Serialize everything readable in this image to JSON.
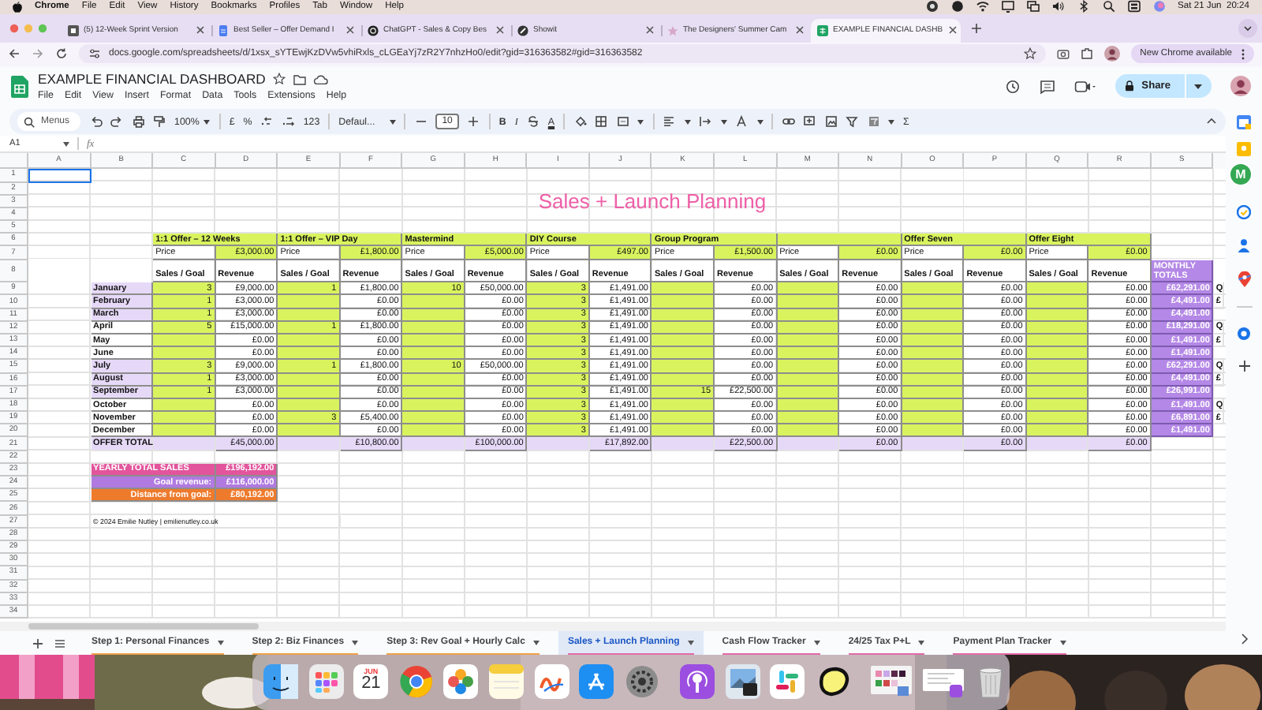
{
  "menu_bar": {
    "app": "Chrome",
    "items": [
      "File",
      "Edit",
      "View",
      "History",
      "Bookmarks",
      "Profiles",
      "Tab",
      "Window",
      "Help"
    ],
    "clock": "Sat 21 Jun  20:24"
  },
  "browser_tabs": [
    {
      "title": "(5) 12-Week Sprint Version",
      "selected": false
    },
    {
      "title": "Best Seller – Offer Demand I",
      "selected": false
    },
    {
      "title": "ChatGPT - Sales & Copy Bes",
      "selected": false
    },
    {
      "title": "Showit",
      "selected": false
    },
    {
      "title": "The Designers' Summer Cam",
      "selected": false
    },
    {
      "title": "EXAMPLE FINANCIAL DASHB",
      "selected": true
    }
  ],
  "address_bar": {
    "url": "docs.google.com/spreadsheets/d/1xsx_sYTEwjKzDVw5vhiRxls_cLGEaYj7zR2Y7nhzHo0/edit?gid=316363582#gid=316363582",
    "update_button": "New Chrome available"
  },
  "document": {
    "title": "EXAMPLE FINANCIAL DASHBOARD",
    "menus": [
      "File",
      "Edit",
      "View",
      "Insert",
      "Format",
      "Data",
      "Tools",
      "Extensions",
      "Help"
    ],
    "share": "Share"
  },
  "toolbar": {
    "search": "Menus",
    "zoom": "100%",
    "currency": "£",
    "percent": "%",
    "number_format": "123",
    "font": "Defaul...",
    "font_size": "10",
    "bold": "B",
    "italic": "I",
    "text_color": "A",
    "sum": "Σ"
  },
  "formula_bar": {
    "cell": "A1",
    "fx": "fx"
  },
  "sheet": {
    "columns": [
      "A",
      "B",
      "C",
      "D",
      "E",
      "F",
      "G",
      "H",
      "I",
      "J",
      "K",
      "L",
      "M",
      "N",
      "O",
      "P",
      "Q",
      "R",
      "S"
    ],
    "rows": [
      "1",
      "2",
      "3",
      "4",
      "5",
      "6",
      "7",
      "8",
      "9",
      "10",
      "11",
      "12",
      "13",
      "14",
      "15",
      "16",
      "17",
      "18",
      "19",
      "20",
      "21",
      "22",
      "23",
      "24",
      "25",
      "26",
      "27",
      "28",
      "29",
      "30",
      "31",
      "32",
      "33",
      "34"
    ],
    "title": "Sales + Launch Planning",
    "months": [
      {
        "name": "January",
        "shaded": true,
        "total": "£62,291.00",
        "column_t": "Q"
      },
      {
        "name": "February",
        "shaded": true,
        "total": "£4,491.00",
        "column_t": "£"
      },
      {
        "name": "March",
        "shaded": true,
        "total": "£4,491.00"
      },
      {
        "name": "April",
        "shaded": false,
        "total": "£18,291.00",
        "column_t": "Q"
      },
      {
        "name": "May",
        "shaded": false,
        "total": "£1,491.00",
        "column_t": "£"
      },
      {
        "name": "June",
        "shaded": false,
        "total": "£1,491.00"
      },
      {
        "name": "July",
        "shaded": true,
        "total": "£62,291.00",
        "column_t": "Q"
      },
      {
        "name": "August",
        "shaded": true,
        "total": "£4,491.00",
        "column_t": "£"
      },
      {
        "name": "September",
        "shaded": true,
        "total": "£26,991.00"
      },
      {
        "name": "October",
        "shaded": false,
        "total": "£1,491.00",
        "column_t": "Q"
      },
      {
        "name": "November",
        "shaded": false,
        "total": "£6,891.00",
        "column_t": "£"
      },
      {
        "name": "December",
        "shaded": false,
        "total": "£1,491.00"
      }
    ],
    "offers": [
      {
        "name": "1:1 Offer – 12 Weeks",
        "price_label": "Price",
        "price": "£3,000.00",
        "sales_header": "Sales / Goal",
        "revenue_header": "Revenue",
        "total": "£45,000.00",
        "rows": [
          {
            "sales": "3",
            "revenue": "£9,000.00"
          },
          {
            "sales": "1",
            "revenue": "£3,000.00"
          },
          {
            "sales": "1",
            "revenue": "£3,000.00"
          },
          {
            "sales": "5",
            "revenue": "£15,000.00"
          },
          {
            "revenue": "£0.00"
          },
          {
            "revenue": "£0.00"
          },
          {
            "sales": "3",
            "revenue": "£9,000.00"
          },
          {
            "sales": "1",
            "revenue": "£3,000.00"
          },
          {
            "sales": "1",
            "revenue": "£3,000.00"
          },
          {
            "revenue": "£0.00"
          },
          {
            "revenue": "£0.00"
          },
          {
            "revenue": "£0.00"
          }
        ]
      },
      {
        "name": "1:1 Offer – VIP Day",
        "price_label": "Price",
        "price": "£1,800.00",
        "sales_header": "Sales / Goal",
        "revenue_header": "Revenue",
        "total": "£10,800.00",
        "rows": [
          {
            "sales": "1",
            "revenue": "£1,800.00"
          },
          {
            "revenue": "£0.00"
          },
          {
            "revenue": "£0.00"
          },
          {
            "sales": "1",
            "revenue": "£1,800.00"
          },
          {
            "revenue": "£0.00"
          },
          {
            "revenue": "£0.00"
          },
          {
            "sales": "1",
            "revenue": "£1,800.00"
          },
          {
            "revenue": "£0.00"
          },
          {
            "revenue": "£0.00"
          },
          {
            "revenue": "£0.00"
          },
          {
            "sales": "3",
            "revenue": "£5,400.00"
          },
          {
            "revenue": "£0.00"
          }
        ]
      },
      {
        "name": "Mastermind",
        "price_label": "Price",
        "price": "£5,000.00",
        "sales_header": "Sales / Goal",
        "revenue_header": "Revenue",
        "total": "£100,000.00",
        "rows": [
          {
            "sales": "10",
            "revenue": "£50,000.00"
          },
          {
            "revenue": "£0.00"
          },
          {
            "revenue": "£0.00"
          },
          {
            "revenue": "£0.00"
          },
          {
            "revenue": "£0.00"
          },
          {
            "revenue": "£0.00"
          },
          {
            "sales": "10",
            "revenue": "£50,000.00"
          },
          {
            "revenue": "£0.00"
          },
          {
            "revenue": "£0.00"
          },
          {
            "revenue": "£0.00"
          },
          {
            "revenue": "£0.00"
          },
          {
            "revenue": "£0.00"
          }
        ]
      },
      {
        "name": "DIY Course",
        "price_label": "Price",
        "price": "£497.00",
        "sales_header": "Sales / Goal",
        "revenue_header": "Revenue",
        "total": "£17,892.00",
        "rows": [
          {
            "sales": "3",
            "revenue": "£1,491.00"
          },
          {
            "sales": "3",
            "revenue": "£1,491.00"
          },
          {
            "sales": "3",
            "revenue": "£1,491.00"
          },
          {
            "sales": "3",
            "revenue": "£1,491.00"
          },
          {
            "sales": "3",
            "revenue": "£1,491.00"
          },
          {
            "sales": "3",
            "revenue": "£1,491.00"
          },
          {
            "sales": "3",
            "revenue": "£1,491.00"
          },
          {
            "sales": "3",
            "revenue": "£1,491.00"
          },
          {
            "sales": "3",
            "revenue": "£1,491.00"
          },
          {
            "sales": "3",
            "revenue": "£1,491.00"
          },
          {
            "sales": "3",
            "revenue": "£1,491.00"
          },
          {
            "sales": "3",
            "revenue": "£1,491.00"
          }
        ]
      },
      {
        "name": "Group Program",
        "price_label": "Price",
        "price": "£1,500.00",
        "sales_header": "Sales / Goal",
        "revenue_header": "Revenue",
        "total": "£22,500.00",
        "rows": [
          {
            "revenue": "£0.00"
          },
          {
            "revenue": "£0.00"
          },
          {
            "revenue": "£0.00"
          },
          {
            "revenue": "£0.00"
          },
          {
            "revenue": "£0.00"
          },
          {
            "revenue": "£0.00"
          },
          {
            "revenue": "£0.00"
          },
          {
            "revenue": "£0.00"
          },
          {
            "sales": "15",
            "revenue": "£22,500.00"
          },
          {
            "revenue": "£0.00"
          },
          {
            "revenue": "£0.00"
          },
          {
            "revenue": "£0.00"
          }
        ]
      },
      {
        "price_label": "Price",
        "price": "£0.00",
        "sales_header": "Sales / Goal",
        "revenue_header": "Revenue",
        "total": "£0.00",
        "rows": [
          {
            "revenue": "£0.00"
          },
          {
            "revenue": "£0.00"
          },
          {
            "revenue": "£0.00"
          },
          {
            "revenue": "£0.00"
          },
          {
            "revenue": "£0.00"
          },
          {
            "revenue": "£0.00"
          },
          {
            "revenue": "£0.00"
          },
          {
            "revenue": "£0.00"
          },
          {
            "revenue": "£0.00"
          },
          {
            "revenue": "£0.00"
          },
          {
            "revenue": "£0.00"
          },
          {
            "revenue": "£0.00"
          }
        ]
      },
      {
        "name": "Offer Seven",
        "price_label": "Price",
        "price": "£0.00",
        "sales_header": "Sales / Goal",
        "revenue_header": "Revenue",
        "total": "£0.00",
        "rows": [
          {
            "revenue": "£0.00"
          },
          {
            "revenue": "£0.00"
          },
          {
            "revenue": "£0.00"
          },
          {
            "revenue": "£0.00"
          },
          {
            "revenue": "£0.00"
          },
          {
            "revenue": "£0.00"
          },
          {
            "revenue": "£0.00"
          },
          {
            "revenue": "£0.00"
          },
          {
            "revenue": "£0.00"
          },
          {
            "revenue": "£0.00"
          },
          {
            "revenue": "£0.00"
          },
          {
            "revenue": "£0.00"
          }
        ]
      },
      {
        "name": "Offer Eight",
        "price_label": "Price",
        "price": "£0.00",
        "sales_header": "Sales / Goal",
        "revenue_header": "Revenue",
        "total": "£0.00",
        "rows": [
          {
            "revenue": "£0.00"
          },
          {
            "revenue": "£0.00"
          },
          {
            "revenue": "£0.00"
          },
          {
            "revenue": "£0.00"
          },
          {
            "revenue": "£0.00"
          },
          {
            "revenue": "£0.00"
          },
          {
            "revenue": "£0.00"
          },
          {
            "revenue": "£0.00"
          },
          {
            "revenue": "£0.00"
          },
          {
            "revenue": "£0.00"
          },
          {
            "revenue": "£0.00"
          },
          {
            "revenue": "£0.00"
          }
        ]
      }
    ],
    "total_label": "OFFER TOTAL",
    "monthly_totals_header": "MONTHLY TOTALS",
    "summary": [
      {
        "label": "YEARLY TOTAL SALES",
        "value": "£196,192.00",
        "color": "#e2559c"
      },
      {
        "label": "Goal revenue:",
        "value": "£116,000.00",
        "color": "#b07ae0"
      },
      {
        "label": "Distance from goal:",
        "value": "£80,192.00",
        "color": "#ee7a2c"
      }
    ],
    "footer": "© 2024 Emilie Nutley | emilienutley.co.uk"
  },
  "sheet_tabs": [
    {
      "label": "Step 1: Personal Finances",
      "selected": false,
      "color": "#f0a04a"
    },
    {
      "label": "Step 2: Biz Finances",
      "selected": false,
      "color": "#f0a04a"
    },
    {
      "label": "Step 3: Rev Goal + Hourly Calc",
      "selected": false,
      "color": "#f0a04a"
    },
    {
      "label": "Sales + Launch Planning",
      "selected": true,
      "color": "#e36aa8"
    },
    {
      "label": "Cash Flow Tracker",
      "selected": false,
      "color": "#e36aa8"
    },
    {
      "label": "24/25 Tax P+L",
      "selected": false,
      "color": "#e36aa8"
    },
    {
      "label": "Payment Plan Tracker",
      "selected": false,
      "color": "#e36aa8"
    }
  ],
  "side_panel": {
    "avatar_letter": "M"
  },
  "dock": {
    "calendar_month": "JUN",
    "calendar_day": "21"
  }
}
